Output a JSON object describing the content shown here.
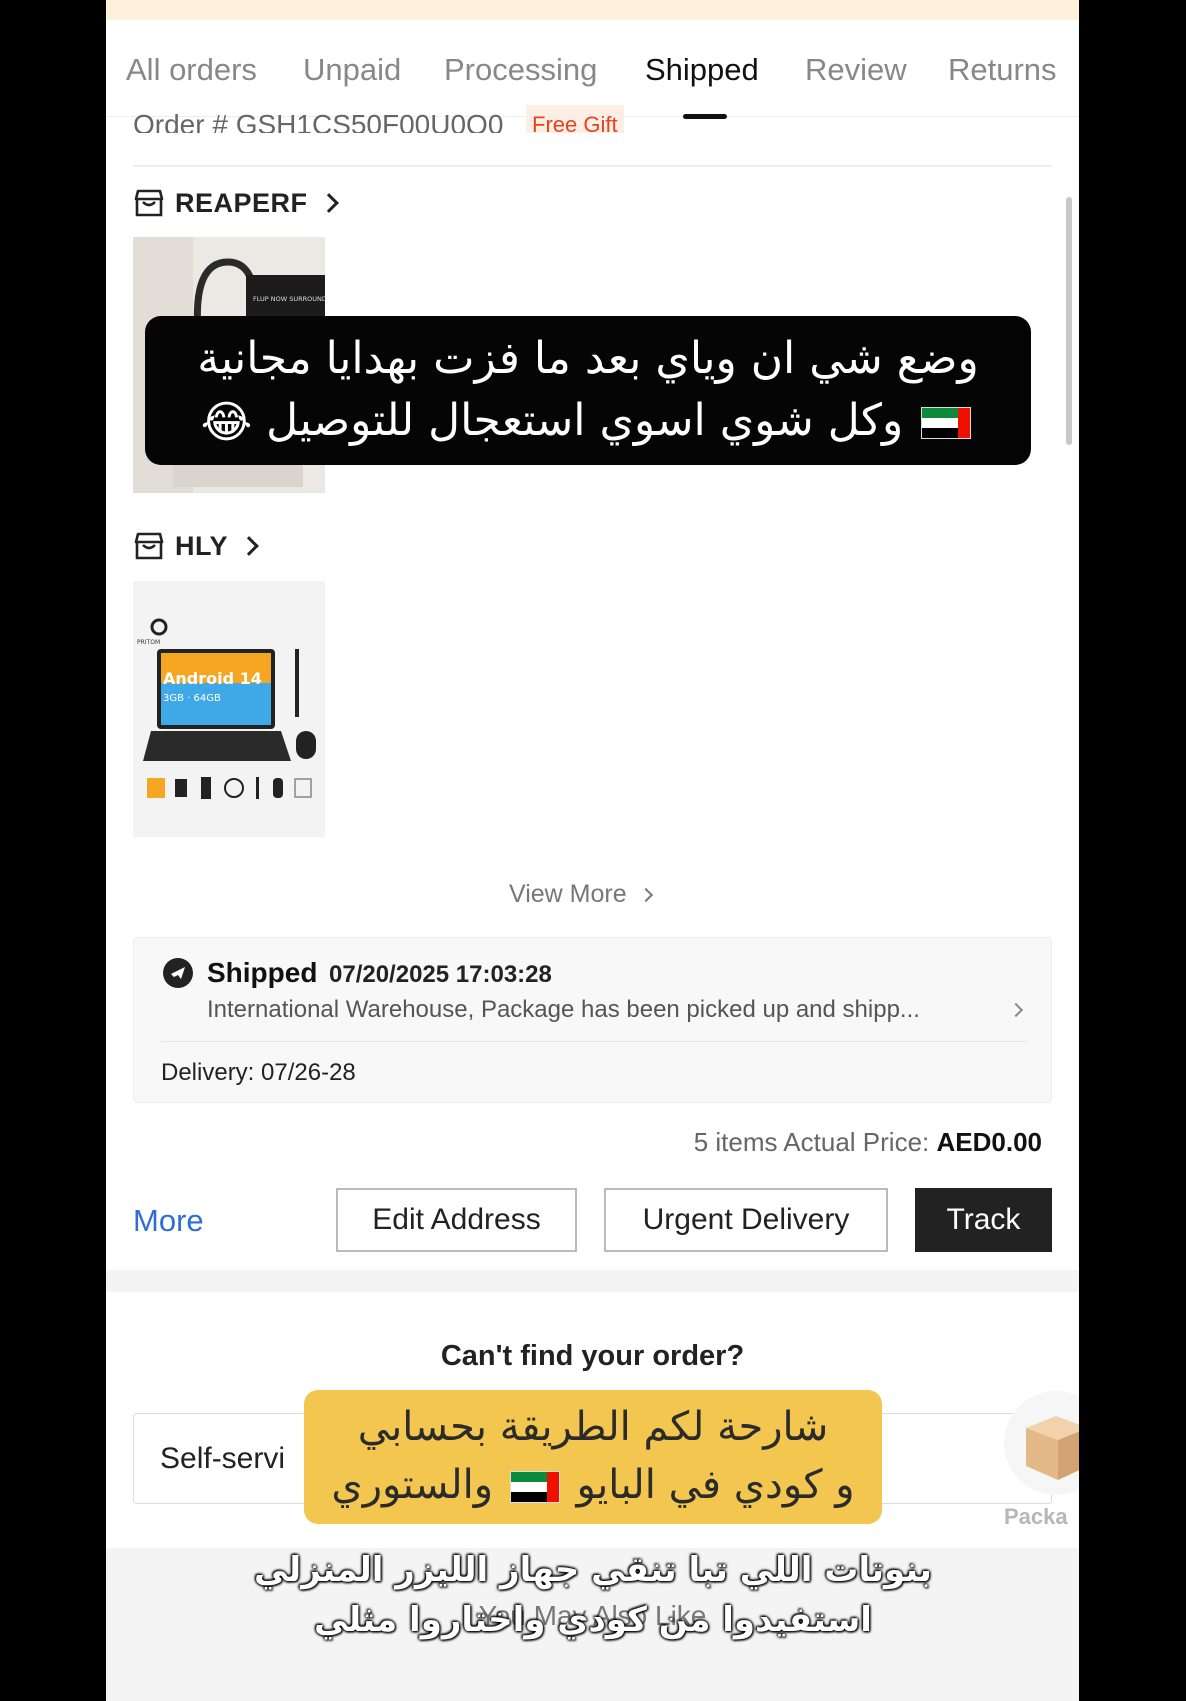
{
  "tabs": [
    "All orders",
    "Unpaid",
    "Processing",
    "Shipped",
    "Review",
    "Returns"
  ],
  "active_tab": "Shipped",
  "order": {
    "number_label": "Order #",
    "number": "GSH1CS50F00U0Q0",
    "tag": "Free Gift"
  },
  "stores": [
    {
      "name": "REAPERF"
    },
    {
      "name": "HLY"
    }
  ],
  "product_image_text": {
    "box_label": "FLUP NOW SURROUNDS UL",
    "tablet_screen": "Android 14",
    "tablet_specs": "3GB · 64GB",
    "brand": "PRITOM"
  },
  "view_more": "View More",
  "shipping": {
    "status": "Shipped",
    "datetime": "07/20/2025 17:03:28",
    "description": "International Warehouse, Package has been picked up and shipp...",
    "delivery_label": "Delivery:",
    "delivery_date": "07/26-28"
  },
  "summary": {
    "label": "5 items Actual Price:",
    "price": "AED0.00"
  },
  "actions": {
    "more": "More",
    "edit_address": "Edit Address",
    "urgent_delivery": "Urgent Delivery",
    "track": "Track"
  },
  "help": {
    "cant_find": "Can't find your order?",
    "self_service": "Self-servi",
    "package_label": "Packa"
  },
  "recommend": "You May Also Like",
  "overlays": {
    "black_line1": "وضع شي ان وياي بعد ما فزت بهدايا مجانية",
    "black_line2": "وكل شوي اسوي استعجال للتوصيل",
    "black_emoji": "😂",
    "yellow_line1": "شارحة لكم الطريقة بحسابي",
    "yellow_line2a": "و كودي في البايو",
    "yellow_line2b": "والستوري",
    "caption_line1": "بنوتات اللي تبا تنقي جهاز الليزر المنزلي",
    "caption_line2": "استفيدوا من كودي واختاروا مثلي"
  },
  "colors": {
    "accent_link": "#2e6fd6",
    "free_gift": "#e8431b",
    "banner": "#fdf1dc",
    "overlay_yellow": "#f3c74f"
  }
}
